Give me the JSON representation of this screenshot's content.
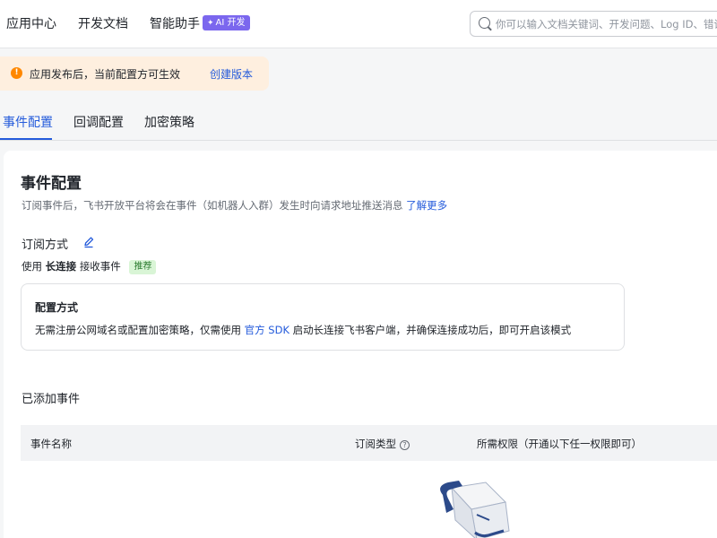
{
  "topbar": {
    "nav": [
      "应用中心",
      "开发文档",
      "智能助手"
    ],
    "ai_badge": "AI 开发",
    "search": {
      "placeholder": "你可以输入文档关键词、开发问题、Log ID、错误码"
    }
  },
  "notice": {
    "text": "应用发布后，当前配置方可生效",
    "link": "创建版本"
  },
  "tabs": [
    "事件配置",
    "回调配置",
    "加密策略"
  ],
  "main": {
    "title": "事件配置",
    "desc": "订阅事件后，飞书开放平台将会在事件（如机器人入群）发生时向请求地址推送消息",
    "desc_link": "了解更多",
    "subscription": {
      "title": "订阅方式",
      "prefix": "使用",
      "method": "长连接",
      "suffix": "接收事件",
      "tag": "推荐"
    },
    "config": {
      "title": "配置方式",
      "desc_pre": "无需注册公网域名或配置加密策略，仅需使用",
      "desc_link": "官方 SDK",
      "desc_post": "启动长连接飞书客户端，并确保连接成功后，即可开启该模式"
    },
    "events": {
      "title": "已添加事件",
      "columns": [
        "事件名称",
        "订阅类型",
        "所需权限（开通以下任一权限即可）"
      ]
    }
  },
  "colors": {
    "accent": "#245bdb",
    "warning": "#ff8800",
    "ai": "#7b67ee",
    "tag_bg": "#d9f5d6"
  }
}
